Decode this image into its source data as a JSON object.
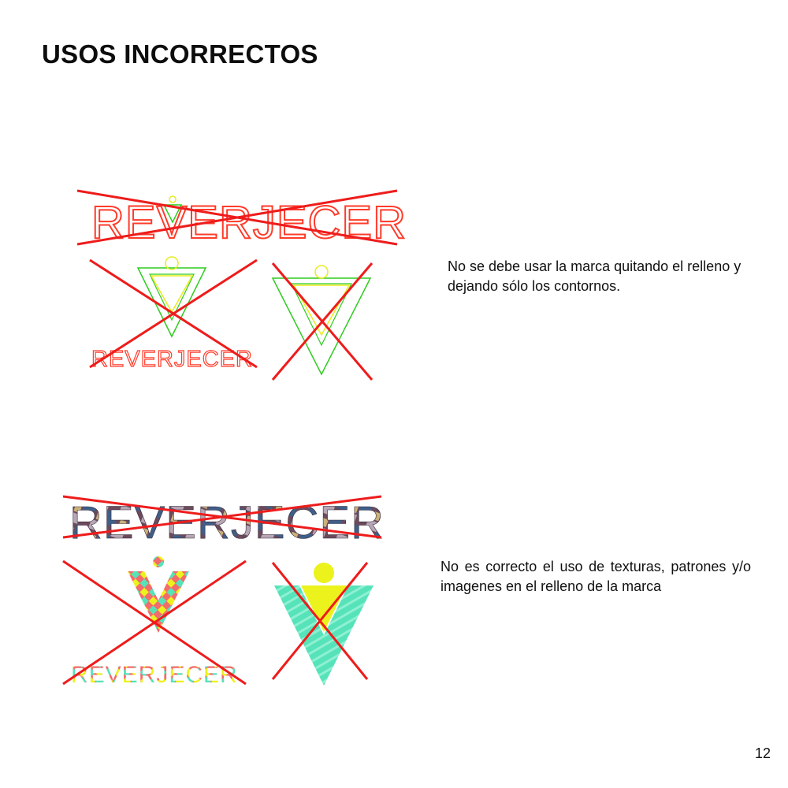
{
  "page": {
    "title": "USOS INCORRECTOS",
    "page_number": "12"
  },
  "brand": {
    "wordmark": "REVERJECER"
  },
  "notes": [
    {
      "text": "No se debe usar la marca quitando el relleno y dejando sólo los contornos."
    },
    {
      "text": "No es correcto el uso de texturas, patrones y/o imagenes en el relleno de la marca"
    }
  ],
  "colors": {
    "cross": "#ee1c1c",
    "outline_red": "#ff3b2a",
    "outline_green": "#2ecc1e",
    "outline_yellow": "#e8ec1e",
    "texture_teal": "#57e3b9",
    "texture_lime": "#ecf21c"
  }
}
